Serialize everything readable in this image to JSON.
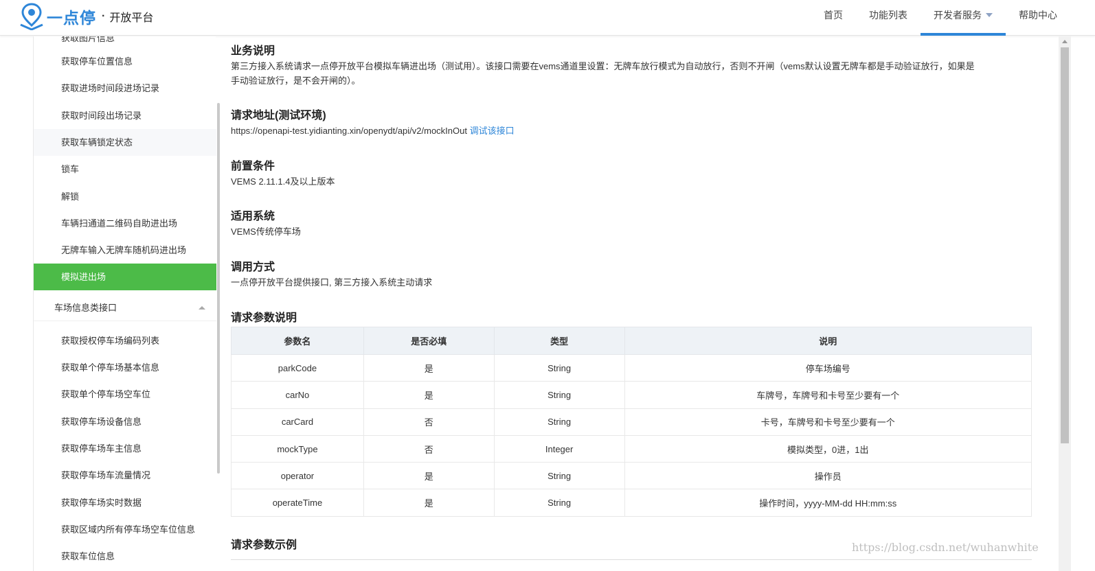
{
  "header": {
    "brand": "一点停",
    "dot": "·",
    "subtitle": "开放平台",
    "nav": [
      {
        "label": "首页"
      },
      {
        "label": "功能列表"
      },
      {
        "label": "开发者服务"
      },
      {
        "label": "帮助中心"
      }
    ],
    "accent_color": "#2e86d8"
  },
  "sidebar": {
    "partial_item": "获取图片信息",
    "items_top": [
      "获取停车位置信息",
      "获取进场时间段进场记录",
      "获取时间段出场记录",
      "获取车辆锁定状态",
      "锁车",
      "解锁",
      "车辆扫通道二维码自助进出场",
      "无牌车输入无牌车随机码进出场",
      "模拟进出场"
    ],
    "active_index": 8,
    "active_color": "#4cbb48",
    "group_label": "车场信息类接口",
    "items_bottom": [
      "获取授权停车场编码列表",
      "获取单个停车场基本信息",
      "获取单个停车场空车位",
      "获取停车场设备信息",
      "获取停车场车主信息",
      "获取停车场车流量情况",
      "获取停车场实时数据",
      "获取区域内所有停车场空车位信息",
      "获取车位信息"
    ]
  },
  "content": {
    "biz_title": "业务说明",
    "biz_text_1": "第三方接入系统请求一点停开放平台模拟车辆进出场（测试用）。该接口需要在vems通道里设置：无牌车放行模式为自动放行，否则不开闸（vems默认设置无牌车都是手动验证放行，如果是",
    "biz_text_2": "手动验证放行，是不会开闸的）。",
    "url_title": "请求地址(测试环境)",
    "url": "https://openapi-test.yidianting.xin/openydt/api/v2/mockInOut",
    "debug_link": "调试该接口",
    "pre_title": "前置条件",
    "pre_text": "VEMS 2.11.1.4及以上版本",
    "sys_title": "适用系统",
    "sys_text": "VEMS传统停车场",
    "call_title": "调用方式",
    "call_text": "一点停开放平台提供接口, 第三方接入系统主动请求",
    "params_title": "请求参数说明",
    "table": {
      "headers": [
        "参数名",
        "是否必填",
        "类型",
        "说明"
      ],
      "rows": [
        [
          "parkCode",
          "是",
          "String",
          "停车场编号"
        ],
        [
          "carNo",
          "是",
          "String",
          "车牌号，车牌号和卡号至少要有一个"
        ],
        [
          "carCard",
          "否",
          "String",
          "卡号，车牌号和卡号至少要有一个"
        ],
        [
          "mockType",
          "否",
          "Integer",
          "模拟类型，0进，1出"
        ],
        [
          "operator",
          "是",
          "String",
          "操作员"
        ],
        [
          "operateTime",
          "是",
          "String",
          "操作时间，yyyy-MM-dd HH:mm:ss"
        ]
      ]
    },
    "example_title": "请求参数示例"
  },
  "watermark": "https://blog.csdn.net/wuhanwhite"
}
